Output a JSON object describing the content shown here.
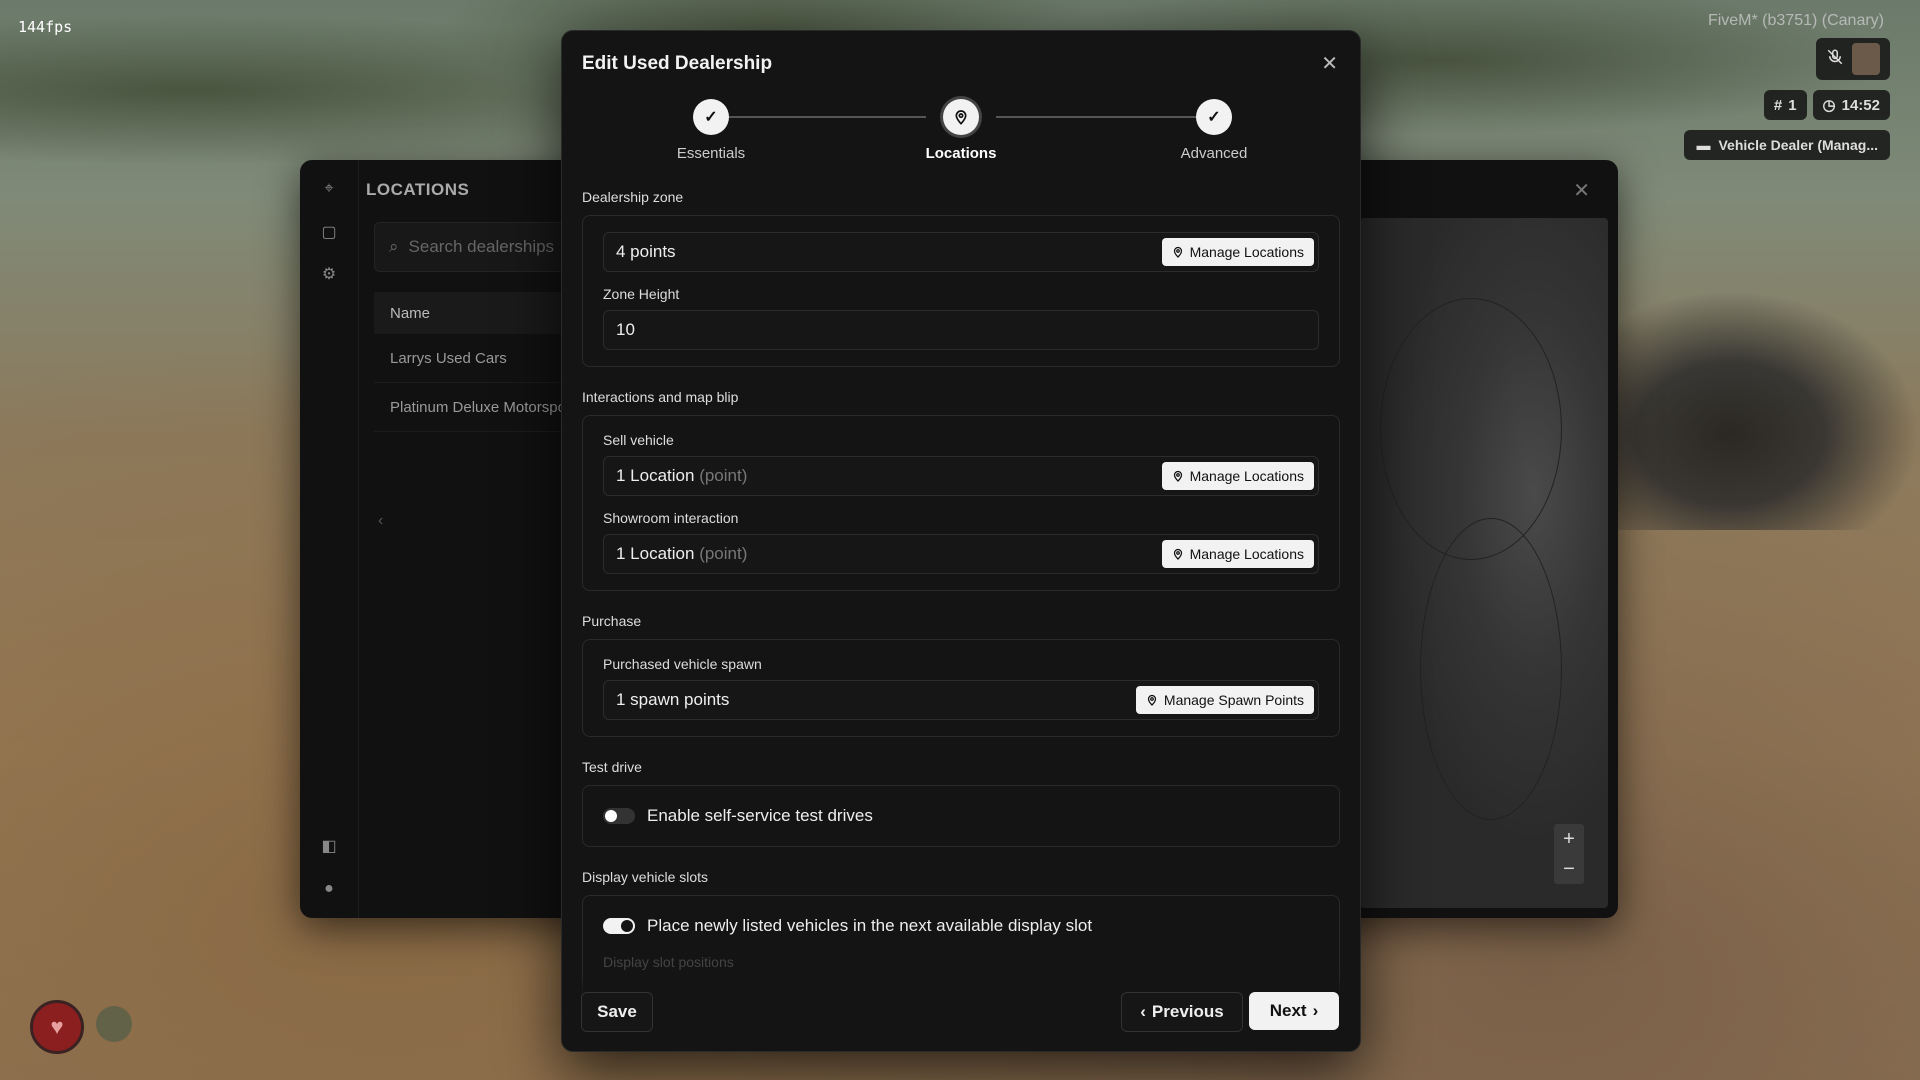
{
  "hud": {
    "fps": "144fps",
    "client": "FiveM* (b3751) (Canary)",
    "player_id": "1",
    "time": "14:52",
    "job": "Vehicle Dealer (Manag..."
  },
  "background_panel": {
    "title": "LOCATIONS",
    "search_placeholder": "Search dealerships",
    "table_header": "Name",
    "rows": [
      "Larrys Used Cars",
      "Platinum Deluxe Motorsports"
    ],
    "zoom_in": "+",
    "zoom_out": "−"
  },
  "modal": {
    "title": "Edit Used Dealership",
    "steps": [
      {
        "label": "Essentials",
        "state": "done"
      },
      {
        "label": "Locations",
        "state": "active"
      },
      {
        "label": "Advanced",
        "state": "done"
      }
    ],
    "sections": {
      "zone": {
        "title": "Dealership zone",
        "points_value": "4 points",
        "manage_label": "Manage Locations",
        "height_label": "Zone Height",
        "height_value": "10"
      },
      "interactions": {
        "title": "Interactions and map blip",
        "sell_label": "Sell vehicle",
        "sell_value": "1 Location",
        "sell_hint": "(point)",
        "sell_manage": "Manage Locations",
        "showroom_label": "Showroom interaction",
        "showroom_value": "1 Location",
        "showroom_hint": "(point)",
        "showroom_manage": "Manage Locations"
      },
      "purchase": {
        "title": "Purchase",
        "spawn_label": "Purchased vehicle spawn",
        "spawn_value": "1 spawn points",
        "spawn_manage": "Manage Spawn Points"
      },
      "test_drive": {
        "title": "Test drive",
        "toggle_label": "Enable self-service test drives",
        "enabled": false
      },
      "display_slots": {
        "title": "Display vehicle slots",
        "toggle_label": "Place newly listed vehicles in the next available display slot",
        "enabled": true,
        "positions_label": "Display slot positions"
      }
    },
    "buttons": {
      "save": "Save",
      "previous": "Previous",
      "next": "Next"
    }
  },
  "colors": {
    "modal_bg": "#141414",
    "accent": "#f2f2f2"
  }
}
